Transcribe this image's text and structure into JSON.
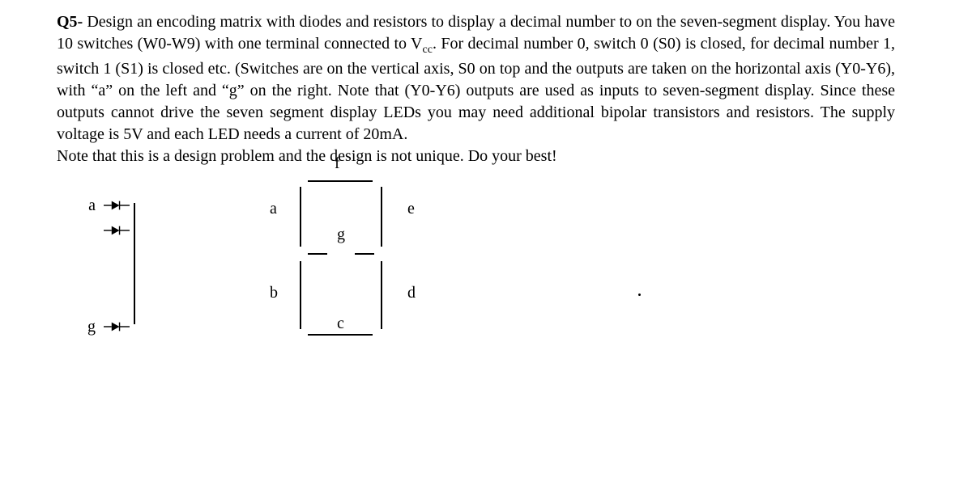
{
  "question": {
    "number": "Q5-",
    "text_before_sub": " Design an encoding matrix with diodes and resistors to display a decimal number to on the seven-segment display. You have 10 switches (W0-W9) with one terminal connected to V",
    "sub": "cc",
    "text_after_sub": ". For decimal number 0, switch 0 (S0) is closed, for decimal number 1, switch 1 (S1) is closed etc. (Switches are on the vertical axis, S0 on top and the outputs are taken on the horizontal axis (Y0-Y6), with “a” on the left and “g” on the right. Note that (Y0-Y6) outputs are used as inputs to seven-segment display. Since these outputs cannot drive the seven segment display LEDs you may need additional bipolar transistors and resistors. The supply voltage is 5V and each LED needs a current of 20mA.",
    "note": "Note that this is a design problem and the design is not unique. Do your best!"
  },
  "diode_labels": {
    "top": "a",
    "bottom": "g"
  },
  "segment_labels": {
    "a": "a",
    "b": "b",
    "c": "c",
    "d": "d",
    "e": "e",
    "f": "f",
    "g": "g"
  }
}
